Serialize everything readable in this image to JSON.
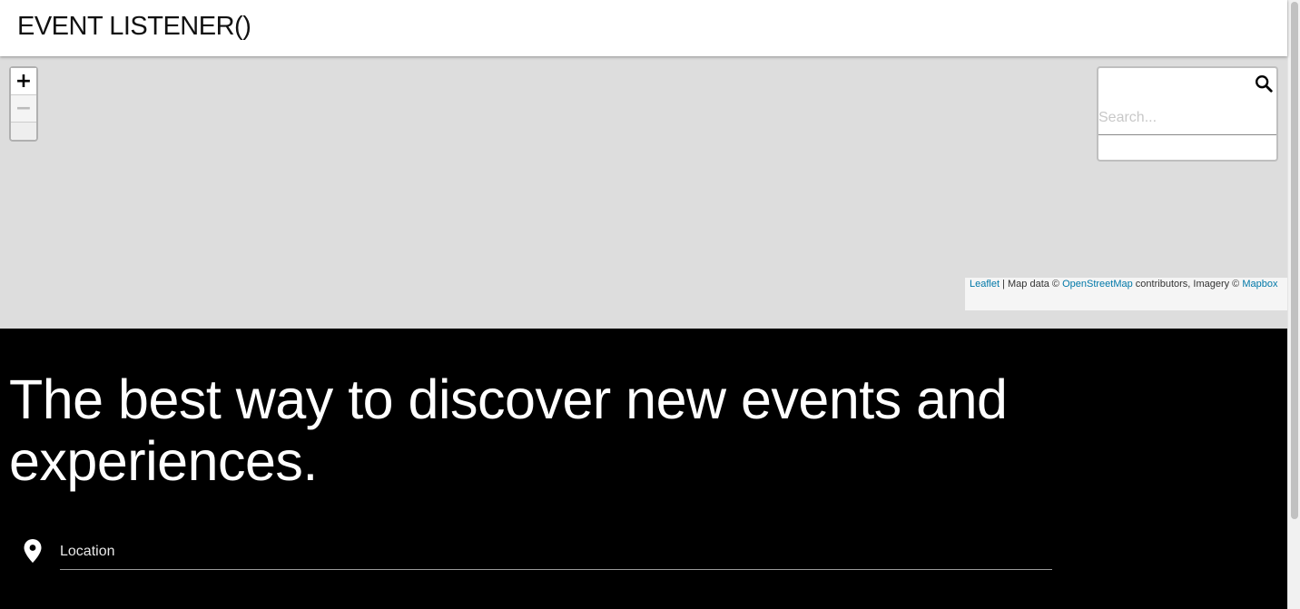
{
  "header": {
    "brand": "EVENT LISTENER()"
  },
  "map": {
    "zoom_in_label": "+",
    "zoom_out_label": "−",
    "search": {
      "placeholder": "Search...",
      "icon": "search-icon"
    },
    "attribution": {
      "leaflet": "Leaflet",
      "sep": " | Map data © ",
      "osm": "OpenStreetMap",
      "mid": " contributors, Imagery © ",
      "mapbox": "Mapbox"
    }
  },
  "hero": {
    "title": "The best way to discover new events and experiences.",
    "location": {
      "placeholder": "Location",
      "icon": "map-pin-icon"
    }
  },
  "colors": {
    "map_bg": "#dddddd",
    "hero_bg": "#000000",
    "link": "#0078a8"
  }
}
